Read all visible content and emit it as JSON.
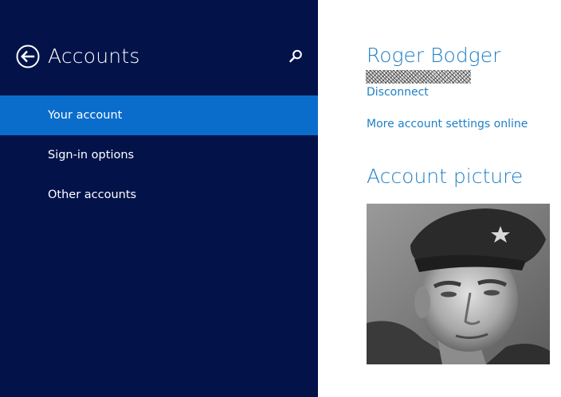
{
  "nav": {
    "title": "Accounts",
    "items": [
      {
        "label": "Your account",
        "selected": true
      },
      {
        "label": "Sign-in options",
        "selected": false
      },
      {
        "label": "Other accounts",
        "selected": false
      }
    ],
    "icons": {
      "back": "back-arrow-circle-icon",
      "search": "search-icon"
    }
  },
  "account": {
    "name": "Roger Bodger",
    "disconnect_label": "Disconnect",
    "more_settings_label": "More account settings online",
    "picture_title": "Account picture"
  },
  "colors": {
    "nav_background": "#03134a",
    "nav_selected": "#0a6dcc",
    "accent_text": "#1f7fc5",
    "content_background": "#ffffff"
  }
}
